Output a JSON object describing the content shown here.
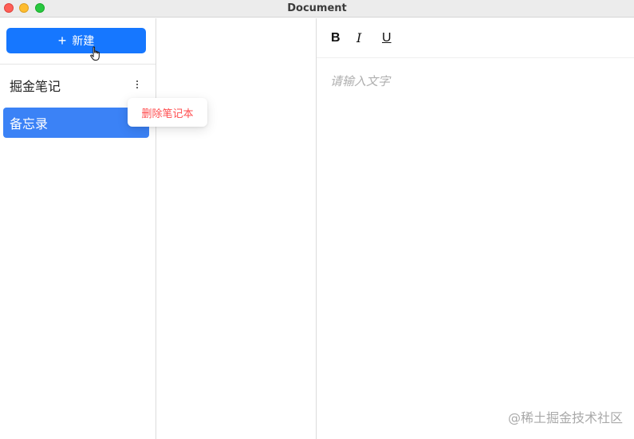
{
  "window": {
    "title": "Document"
  },
  "sidebar": {
    "new_button_label": "新建",
    "notebooks": [
      {
        "label": "掘金笔记",
        "selected": false
      },
      {
        "label": "备忘录",
        "selected": true
      }
    ],
    "context_menu": {
      "delete_label": "删除笔记本"
    }
  },
  "editor": {
    "toolbar": {
      "bold": "B",
      "italic": "I",
      "underline": "U"
    },
    "placeholder": "请输入文字"
  },
  "watermark": "@稀土掘金技术社区",
  "colors": {
    "accent": "#1677ff",
    "selected_item": "#3b82f6",
    "danger": "#ff4d4f"
  }
}
